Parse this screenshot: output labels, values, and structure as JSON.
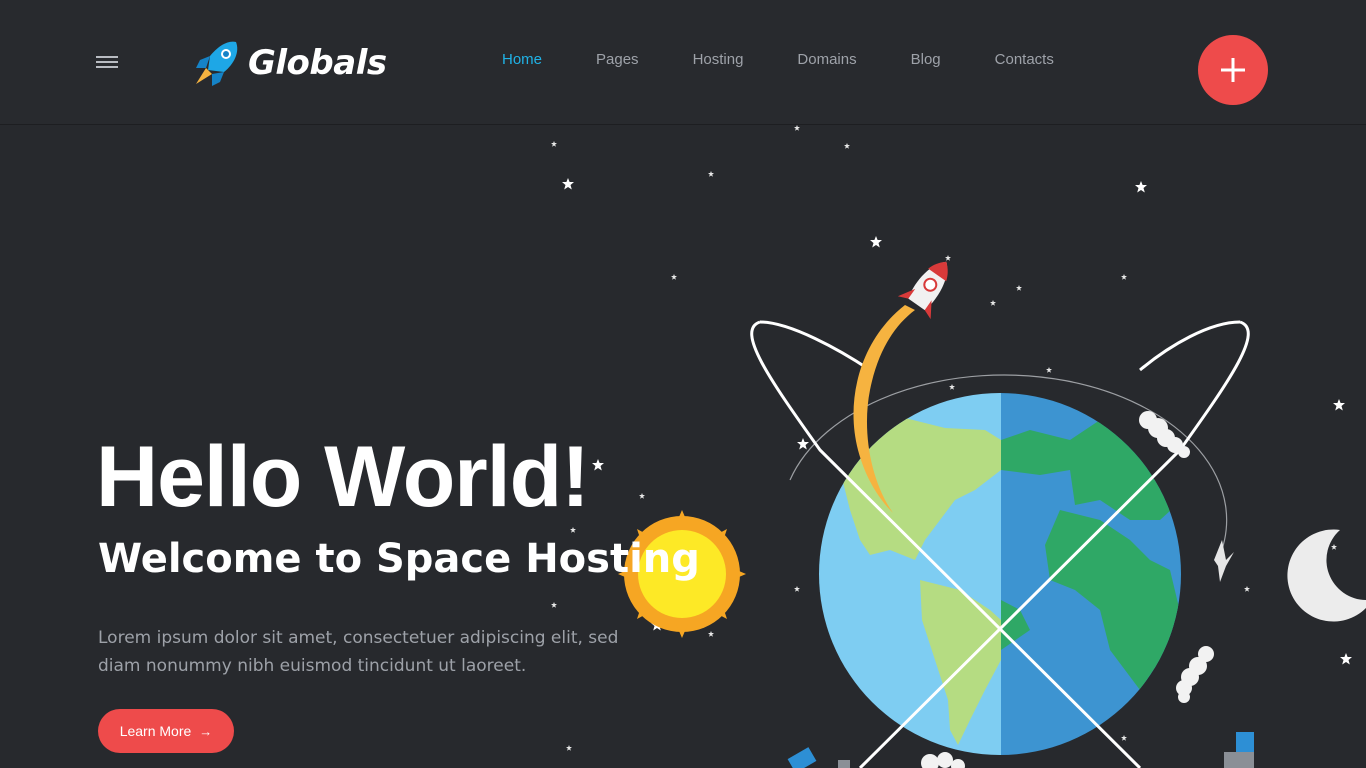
{
  "brand": {
    "name": "Globals"
  },
  "nav": {
    "items": [
      {
        "label": "Home",
        "active": true
      },
      {
        "label": "Pages",
        "active": false
      },
      {
        "label": "Hosting",
        "active": false
      },
      {
        "label": "Domains",
        "active": false
      },
      {
        "label": "Blog",
        "active": false
      },
      {
        "label": "Contacts",
        "active": false
      }
    ]
  },
  "header": {
    "menu_icon": "hamburger-icon",
    "action_icon": "plus-icon"
  },
  "hero": {
    "title": "Hello World!",
    "subtitle": "Welcome to Space Hosting",
    "description": "Lorem ipsum dolor sit amet, consectetuer adipiscing elit, sed diam nonummy nibh euismod tincidunt ut laoreet.",
    "button_label": "Learn More",
    "button_icon": "arrow-right-icon"
  },
  "colors": {
    "background": "#27292d",
    "accent": "#ee4b4b",
    "nav_active": "#20b2e6",
    "nav_text": "#9ea2a9"
  }
}
